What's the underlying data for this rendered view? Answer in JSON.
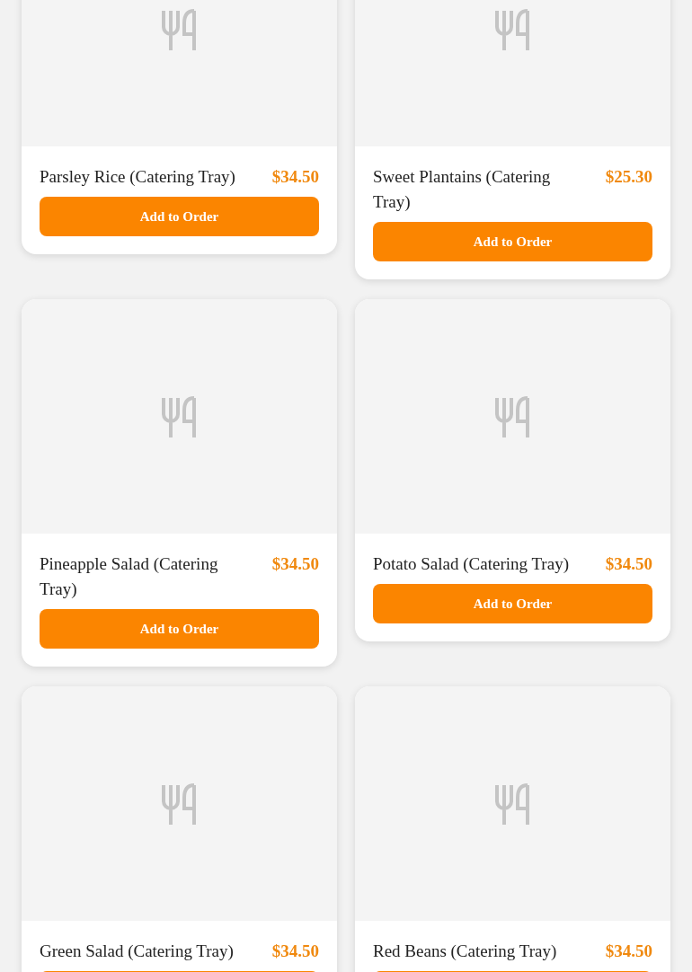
{
  "menu_items": [
    {
      "name": "Parsley Rice (Catering Tray)",
      "price": "$34.50",
      "button_label": "Add to Order"
    },
    {
      "name": "Sweet Plantains (Catering Tray)",
      "price": "$25.30",
      "button_label": "Add to Order"
    },
    {
      "name": "Pineapple Salad (Catering Tray)",
      "price": "$34.50",
      "button_label": "Add to Order"
    },
    {
      "name": "Potato Salad (Catering Tray)",
      "price": "$34.50",
      "button_label": "Add to Order"
    },
    {
      "name": "Green Salad (Catering Tray)",
      "price": "$34.50"
    },
    {
      "name": "Red Beans (Catering Tray)",
      "price": "$34.50"
    }
  ]
}
